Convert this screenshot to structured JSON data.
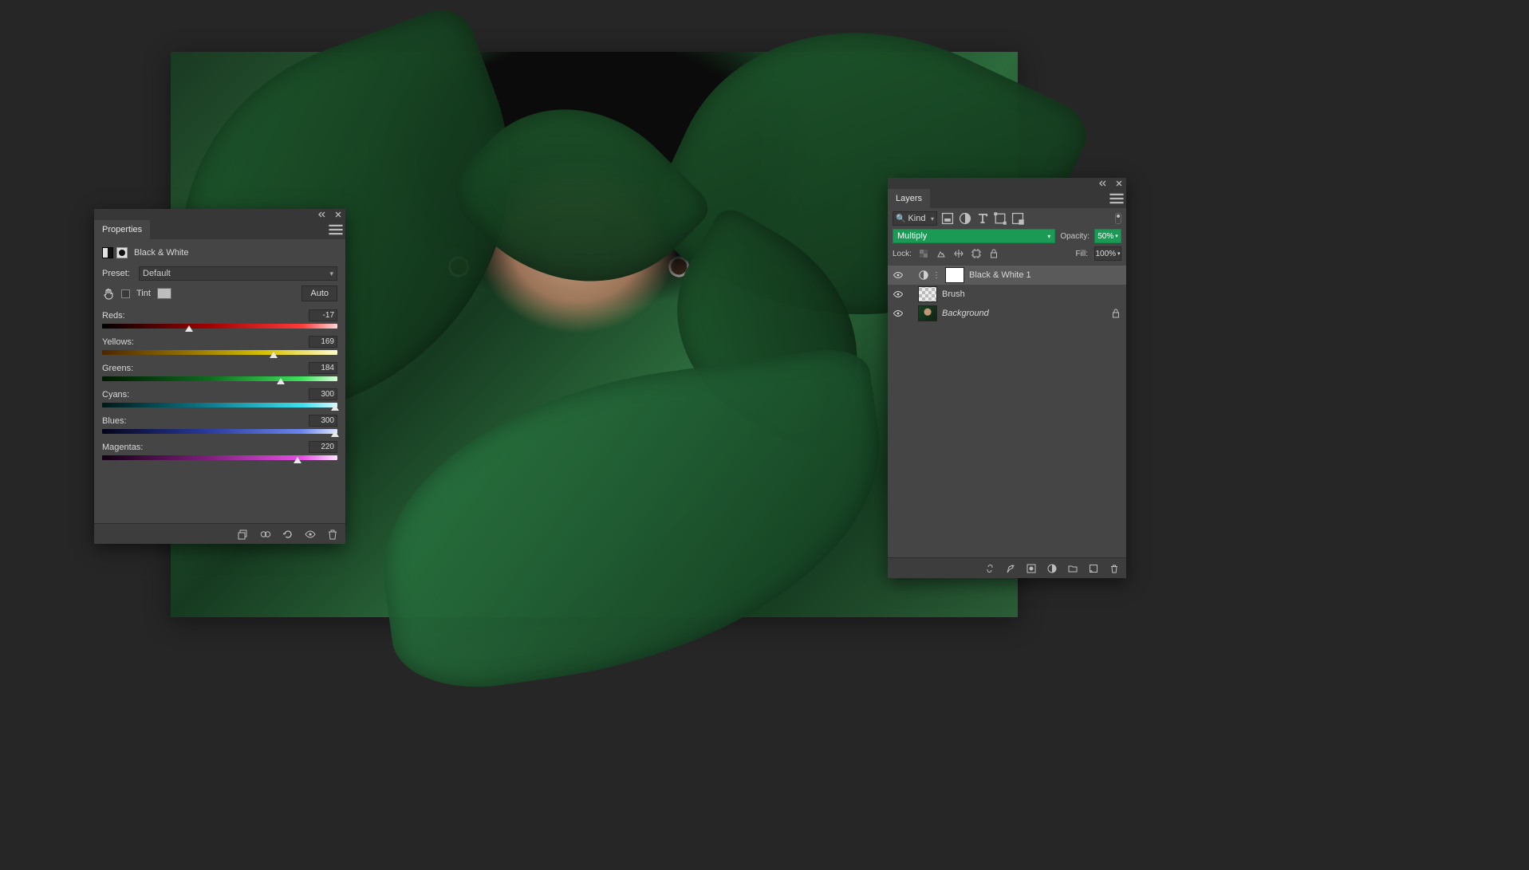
{
  "properties": {
    "tab_label": "Properties",
    "adjustment_name": "Black & White",
    "preset_label": "Preset:",
    "preset_value": "Default",
    "tint_label": "Tint",
    "tint_checked": false,
    "auto_label": "Auto",
    "sliders": {
      "reds": {
        "label": "Reds:",
        "value": "-17",
        "pct": 37
      },
      "yellows": {
        "label": "Yellows:",
        "value": "169",
        "pct": 73
      },
      "greens": {
        "label": "Greens:",
        "value": "184",
        "pct": 76
      },
      "cyans": {
        "label": "Cyans:",
        "value": "300",
        "pct": 99
      },
      "blues": {
        "label": "Blues:",
        "value": "300",
        "pct": 99
      },
      "magentas": {
        "label": "Magentas:",
        "value": "220",
        "pct": 83
      }
    }
  },
  "layers": {
    "tab_label": "Layers",
    "kind_label": "Kind",
    "blend_mode": "Multiply",
    "opacity_label": "Opacity:",
    "opacity_value": "50%",
    "lock_label": "Lock:",
    "fill_label": "Fill:",
    "fill_value": "100%",
    "items": [
      {
        "name": "Black & White 1",
        "type": "adjustment",
        "visible": true,
        "selected": true
      },
      {
        "name": "Brush",
        "type": "raster",
        "visible": true,
        "selected": false
      },
      {
        "name": "Background",
        "type": "background",
        "visible": true,
        "selected": false,
        "locked": true
      }
    ]
  },
  "colors": {
    "accent_green": "#1a9a54",
    "panel_bg": "#454545"
  }
}
